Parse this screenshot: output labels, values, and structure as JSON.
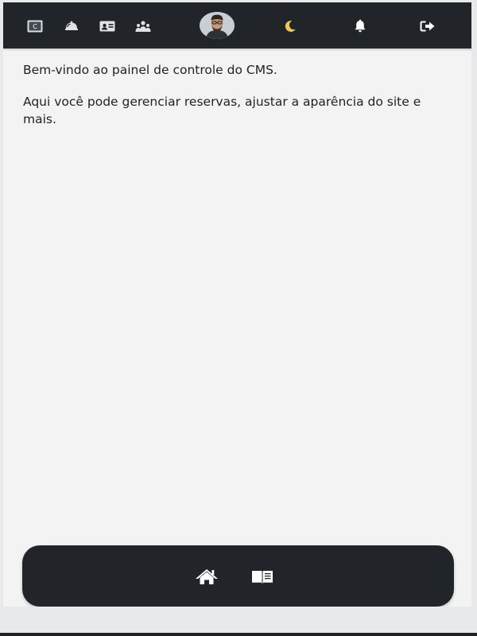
{
  "topbar": {
    "icons": [
      {
        "name": "cms-icon"
      },
      {
        "name": "bookings-icon"
      },
      {
        "name": "contact-card-icon"
      },
      {
        "name": "users-icon"
      },
      {
        "name": "user-avatar"
      },
      {
        "name": "dark-mode-icon"
      },
      {
        "name": "notifications-icon"
      },
      {
        "name": "logout-icon"
      }
    ],
    "cms_icon_text": "C",
    "background": "#212529"
  },
  "main": {
    "welcome_text": "Bem-vindo ao painel de controle do CMS.",
    "description_text": "Aqui você pode gerenciar reservas, ajustar a aparência do site e mais."
  },
  "bottom_nav": {
    "items": [
      {
        "name": "home-icon"
      },
      {
        "name": "book-icon"
      }
    ],
    "background": "#212529"
  },
  "colors": {
    "page_background": "#f3f3f4",
    "text": "#222222",
    "accent_moon": "#f2c94c"
  }
}
